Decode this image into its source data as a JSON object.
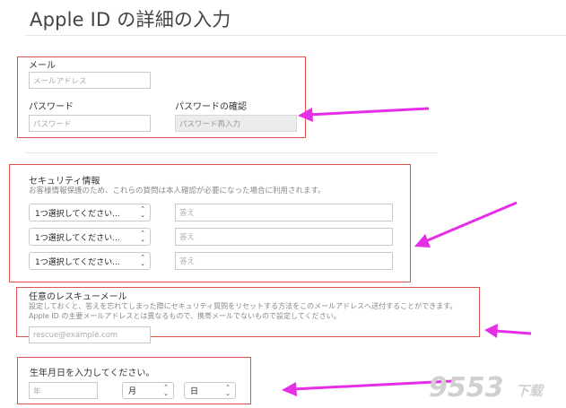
{
  "page": {
    "title": "Apple ID の詳細の入力"
  },
  "account": {
    "email_label": "メール",
    "email_placeholder": "メールアドレス",
    "password_label": "パスワード",
    "password_placeholder": "パスワード",
    "confirm_label": "パスワードの確認",
    "confirm_placeholder": "パスワード再入力"
  },
  "security": {
    "heading": "セキュリティ情報",
    "description": "お客様情報保護のため、これらの質問は本人確認が必要になった場合に利用されます。",
    "questions": [
      {
        "select": "1つ選択してください...",
        "answer_placeholder": "答え"
      },
      {
        "select": "1つ選択してください...",
        "answer_placeholder": "答え"
      },
      {
        "select": "1つ選択してください...",
        "answer_placeholder": "答え"
      }
    ]
  },
  "rescue": {
    "heading": "任意のレスキューメール",
    "description": "設定しておくと、答えを忘れてしまった際にセキュリティ質問をリセットする方法をこのメールアドレスへ送付することができます。Apple ID の主要メールアドレスとは異なるもので、携帯メールでないもので設定してください。",
    "email_placeholder": "rescue@example.com"
  },
  "birthday": {
    "heading": "生年月日を入力してください。",
    "year_placeholder": "年",
    "month_select": "月",
    "day_select": "日"
  },
  "watermark": {
    "text": "9553",
    "suffix": "下载"
  },
  "colors": {
    "highlight_box": "#d9534f",
    "arrow": "#e62ee6"
  }
}
